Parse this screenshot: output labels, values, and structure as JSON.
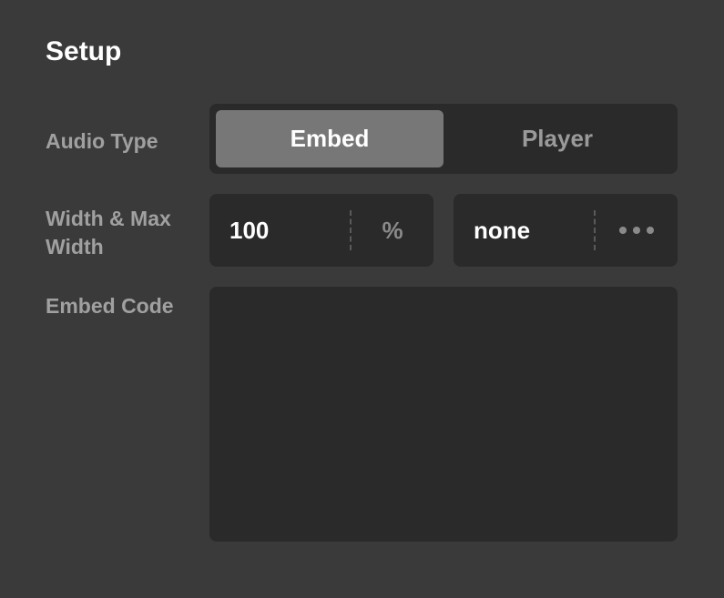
{
  "title": "Setup",
  "labels": {
    "audioType": "Audio Type",
    "widthMax": "Width & Max Width",
    "embedCode": "Embed Code"
  },
  "audioType": {
    "options": [
      "Embed",
      "Player"
    ],
    "selected": "Embed"
  },
  "width": {
    "value": "100",
    "unit": "%"
  },
  "maxWidth": {
    "value": "none"
  },
  "embedCode": {
    "value": ""
  }
}
